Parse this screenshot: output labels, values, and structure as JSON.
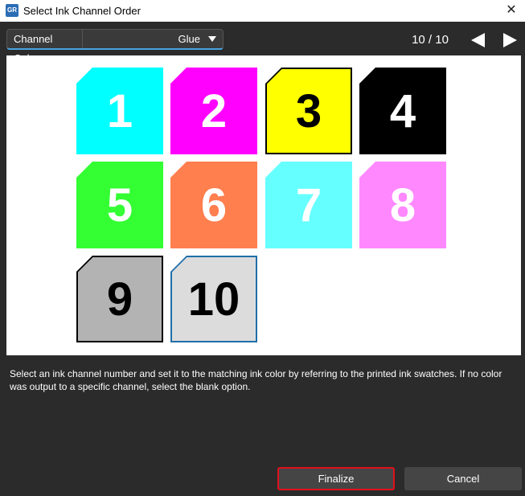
{
  "window": {
    "title": "Select Ink Channel Order",
    "app_icon": "app-logo-icon",
    "app_icon_text": "GR",
    "close_glyph": "✕"
  },
  "toolbar": {
    "channel_label": "Channel Color:",
    "channel_value": "Glue",
    "page_indicator": "10 / 10"
  },
  "swatches": [
    {
      "number": "1",
      "fill": "#00ffff",
      "text_color": "#ffffff"
    },
    {
      "number": "2",
      "fill": "#ff00ff",
      "text_color": "#ffffff"
    },
    {
      "number": "3",
      "fill": "#ffff00",
      "text_color": "#000000"
    },
    {
      "number": "4",
      "fill": "#000000",
      "text_color": "#ffffff"
    },
    {
      "number": "5",
      "fill": "#33ff33",
      "text_color": "#ffffff"
    },
    {
      "number": "6",
      "fill": "#ff7f4f",
      "text_color": "#ffffff"
    },
    {
      "number": "7",
      "fill": "#66ffff",
      "text_color": "#ffffff"
    },
    {
      "number": "8",
      "fill": "#ff88ff",
      "text_color": "#ffffff"
    },
    {
      "number": "9",
      "fill": "#b3b3b3",
      "text_color": "#000000"
    },
    {
      "number": "10",
      "fill": "#dcdcdc",
      "text_color": "#000000",
      "selected": true
    }
  ],
  "instruction": "Select an ink channel number and set it to the matching ink color by referring to the printed ink swatches. If no color was output to a specific channel, select the blank option.",
  "buttons": {
    "finalize": "Finalize",
    "cancel": "Cancel"
  },
  "colors": {
    "background": "#2b2b2b",
    "accent": "#4aa3df",
    "highlight": "#e0101a"
  }
}
